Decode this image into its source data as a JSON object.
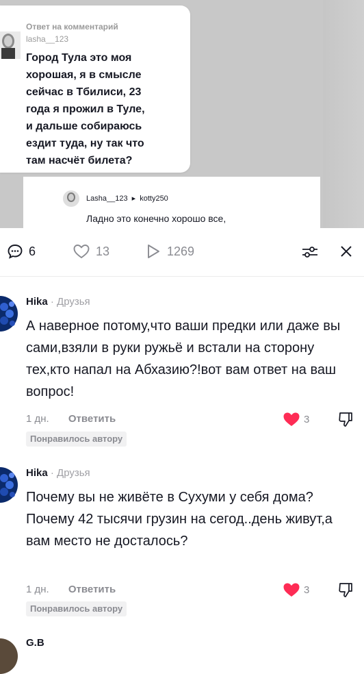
{
  "video_overlay": {
    "reply_header": "Ответ на комментарий",
    "reply_user": "lasha__123",
    "reply_text": "Город Тула это моя\nхорошая, я в смысле\nсейчас в Тбилиси, 23\nгода я прожил в Туле,\nи дальше собираюсь\nездит туда, ну так что\nтам насчёт билета?",
    "second_path_user": "Lasha__123",
    "second_path_arrow": "▸",
    "second_path_target": "kotty250",
    "second_text": "Ладно это конечно хорошо все,"
  },
  "stats": {
    "comments": "6",
    "likes": "13",
    "shares": "1269"
  },
  "comments": [
    {
      "author": "Hika",
      "tag": "Друзья",
      "text": "А наверное потому,что ваши предки или даже вы сами,взяли в руки ружьё и встали на сторону тех,кто напал на Абхазию?!вот вам ответ на ваш вопрос!",
      "time": "1 дн.",
      "reply_label": "Ответить",
      "likes": "3",
      "badge": "Понравилось автору"
    },
    {
      "author": "Hika",
      "tag": "Друзья",
      "text": "Почему вы не живёте в Сухуми у себя дома? Почему 42 тысячи грузин на сегод..день живут,а вам место не досталось?",
      "time": "1 дн.",
      "reply_label": "Ответить",
      "likes": "3",
      "badge": "Понравилось автору"
    },
    {
      "author": "G.B"
    }
  ],
  "colors": {
    "like_red": "#fe2c55",
    "text": "#161823",
    "muted": "#8a8b91"
  }
}
